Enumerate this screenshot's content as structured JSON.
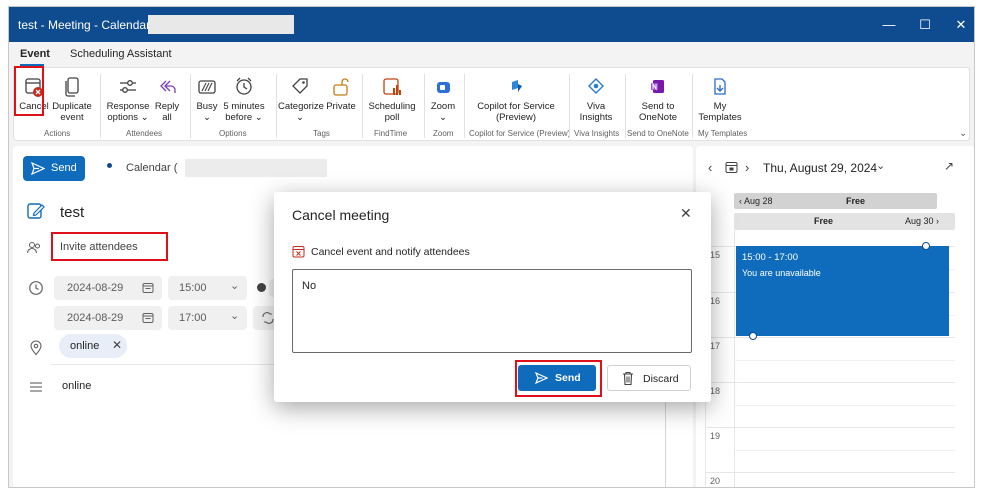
{
  "window": {
    "title": "test - Meeting - Calendar -"
  },
  "ribbon_tabs": [
    "Event",
    "Scheduling Assistant"
  ],
  "ribbon": {
    "cancel": "Cancel",
    "duplicate_1": "Duplicate",
    "duplicate_2": "event",
    "response_1": "Response",
    "response_2": "options ⌄",
    "reply_1": "Reply",
    "reply_2": "all",
    "busy_1": "Busy",
    "busy_2": "⌄",
    "remind_1": "5 minutes",
    "remind_2": "before ⌄",
    "categorize_1": "Categorize",
    "categorize_2": "⌄",
    "private": "Private",
    "sched_1": "Scheduling",
    "sched_2": "poll",
    "zoom_1": "Zoom",
    "zoom_2": "⌄",
    "copilot_1": "Copilot for Service",
    "copilot_2": "(Preview)",
    "viva_1": "Viva",
    "viva_2": "Insights",
    "onenote_1": "Send to",
    "onenote_2": "OneNote",
    "templates_1": "My",
    "templates_2": "Templates",
    "groups": [
      "Actions",
      "Attendees",
      "Options",
      "Tags",
      "FindTime",
      "Zoom",
      "Copilot for Service (Preview)",
      "Viva Insights",
      "Send to OneNote",
      "My Templates"
    ]
  },
  "compose": {
    "send": "Send",
    "calendar_label": "Calendar (",
    "title": "test",
    "attendees_placeholder": "Invite attendees",
    "start_date": "2024-08-29",
    "start_time": "15:00",
    "end_date": "2024-08-29",
    "end_time": "17:00",
    "location_chip": "online",
    "body": "online"
  },
  "calendar": {
    "date_label": "Thu, August 29, 2024",
    "prev_day": "Aug 28",
    "prev_status": "Free",
    "status": "Free",
    "next_day": "Aug 30",
    "hours": [
      "15",
      "16",
      "17",
      "18",
      "19",
      "20"
    ],
    "event_time": "15:00 - 17:00",
    "event_note": "You are unavailable",
    "event_color": "#0f6cbd"
  },
  "dialog": {
    "title": "Cancel meeting",
    "subtitle": "Cancel event and notify attendees",
    "message": "No",
    "send": "Send",
    "discard": "Discard"
  },
  "colors": {
    "accent": "#0f6cbd",
    "titlebar": "#0f4c8f",
    "highlight": "#e0101a"
  }
}
